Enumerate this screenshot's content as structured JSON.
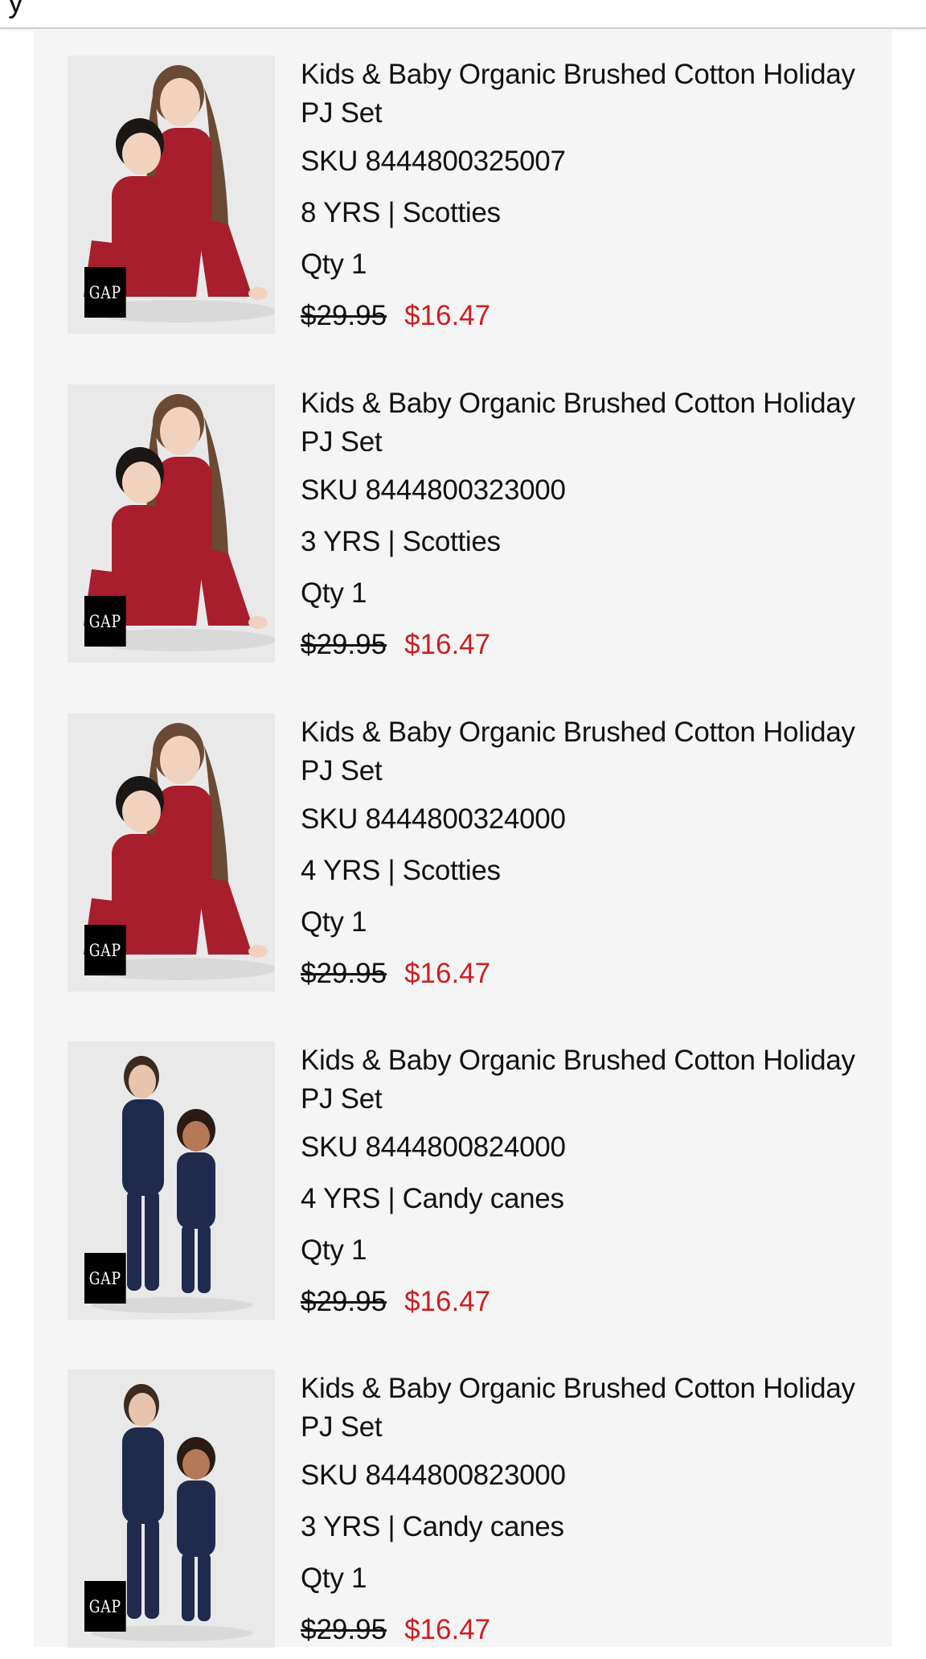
{
  "header": {
    "partial_text": "y"
  },
  "items": [
    {
      "title": "Kids & Baby Organic Brushed Cotton Holiday PJ Set",
      "sku": "SKU 8444800325007",
      "variant": "8 YRS | Scotties",
      "qty": "Qty 1",
      "price_original": "$29.95",
      "price_sale": "$16.47",
      "image_brand": "GAP",
      "pj_color": "#a81e2c"
    },
    {
      "title": "Kids & Baby Organic Brushed Cotton Holiday PJ Set",
      "sku": "SKU 8444800323000",
      "variant": "3 YRS | Scotties",
      "qty": "Qty 1",
      "price_original": "$29.95",
      "price_sale": "$16.47",
      "image_brand": "GAP",
      "pj_color": "#a81e2c"
    },
    {
      "title": "Kids & Baby Organic Brushed Cotton Holiday PJ Set",
      "sku": "SKU 8444800324000",
      "variant": "4 YRS | Scotties",
      "qty": "Qty 1",
      "price_original": "$29.95",
      "price_sale": "$16.47",
      "image_brand": "GAP",
      "pj_color": "#a81e2c"
    },
    {
      "title": "Kids & Baby Organic Brushed Cotton Holiday PJ Set",
      "sku": "SKU 8444800824000",
      "variant": "4 YRS | Candy canes",
      "qty": "Qty 1",
      "price_original": "$29.95",
      "price_sale": "$16.47",
      "image_brand": "GAP",
      "pj_color": "#1f2a4d"
    },
    {
      "title": "Kids & Baby Organic Brushed Cotton Holiday PJ Set",
      "sku": "SKU 8444800823000",
      "variant": "3 YRS | Candy canes",
      "qty": "Qty 1",
      "price_original": "$29.95",
      "price_sale": "$16.47",
      "image_brand": "GAP",
      "pj_color": "#1f2a4d"
    }
  ],
  "colors": {
    "sale_price": "#cc1f1f",
    "panel_bg": "#f5f5f6"
  }
}
